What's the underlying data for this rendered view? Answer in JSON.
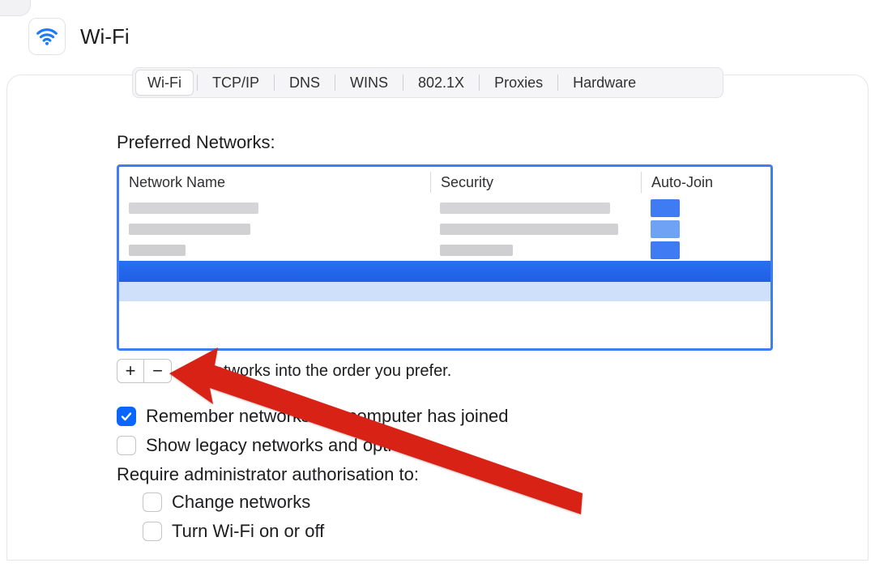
{
  "page": {
    "title": "Wi-Fi"
  },
  "tabs": [
    {
      "label": "Wi-Fi",
      "active": true
    },
    {
      "label": "TCP/IP",
      "active": false
    },
    {
      "label": "DNS",
      "active": false
    },
    {
      "label": "WINS",
      "active": false
    },
    {
      "label": "802.1X",
      "active": false
    },
    {
      "label": "Proxies",
      "active": false
    },
    {
      "label": "Hardware",
      "active": false
    }
  ],
  "preferred_networks": {
    "heading": "Preferred Networks:",
    "columns": {
      "name": "Network Name",
      "security": "Security",
      "autojoin": "Auto-Join"
    },
    "rows_redacted": 4,
    "selected_row_index": 3,
    "drag_hint_partial": "ag networks into the order you prefer."
  },
  "buttons": {
    "add": "+",
    "remove": "−"
  },
  "checkboxes": {
    "remember": {
      "label": "Remember networks this computer has joined",
      "checked": true
    },
    "legacy": {
      "label": "Show legacy networks and options",
      "checked": false
    },
    "admin_heading": "Require administrator authorisation to:",
    "change_networks": {
      "label": "Change networks",
      "checked": false
    },
    "turn_wifi": {
      "label": "Turn Wi-Fi on or off",
      "checked": false
    }
  },
  "colors": {
    "accent": "#0a66ff",
    "selection": "#2a6ff1",
    "table_border": "#3e7ef2",
    "arrow": "#d92418"
  }
}
